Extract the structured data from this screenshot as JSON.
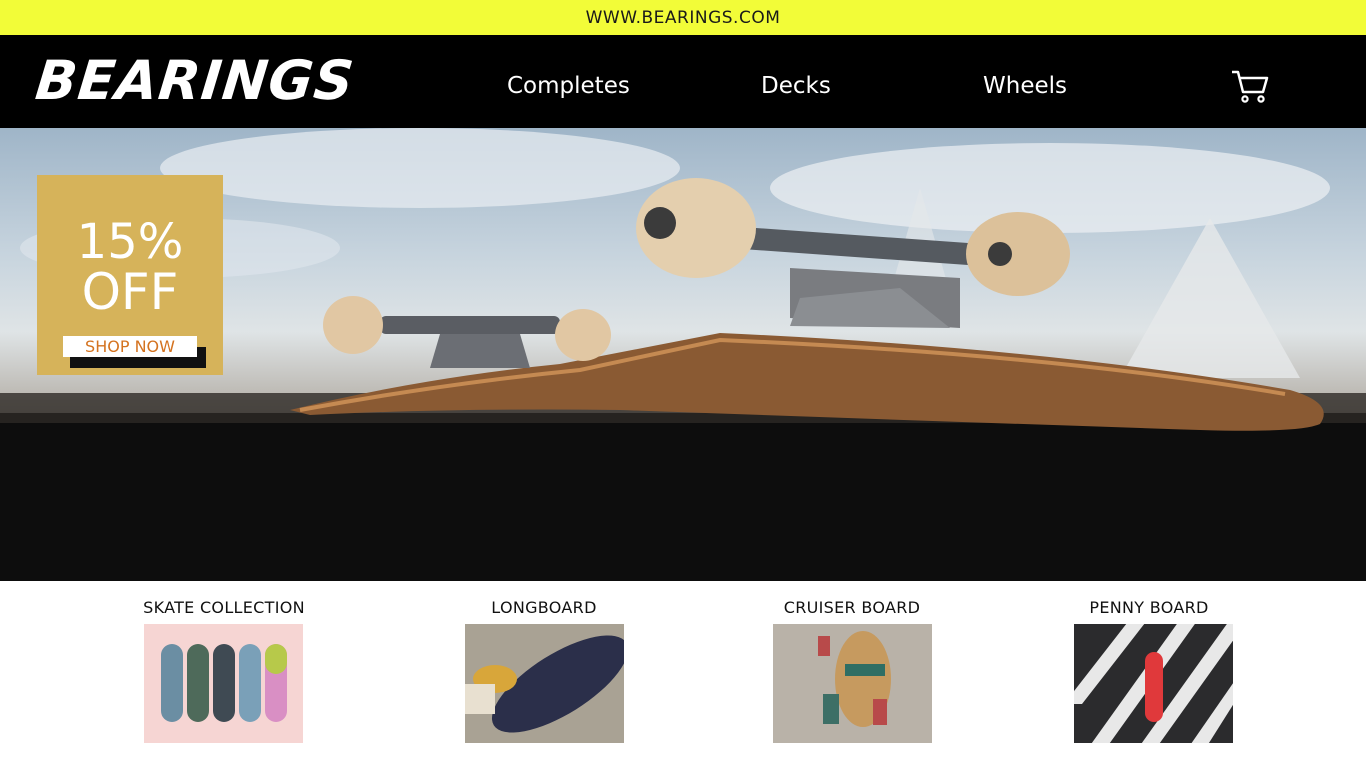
{
  "topbar": {
    "url": "WWW.BEARINGS.COM"
  },
  "nav": {
    "logo": "BEARINGS",
    "links": [
      "Completes",
      "Decks",
      "Wheels"
    ],
    "cart_icon": "cart-icon"
  },
  "hero": {
    "promo": {
      "percent": "15%",
      "off": "OFF",
      "cta": "SHOP NOW"
    },
    "colors": {
      "promo_bg": "#d6b35a",
      "cta_text": "#d47320"
    }
  },
  "categories": [
    {
      "title": "SKATE COLLECTION"
    },
    {
      "title": "LONGBOARD"
    },
    {
      "title": "CRUISER BOARD"
    },
    {
      "title": "PENNY BOARD"
    }
  ],
  "colors": {
    "topbar": "#f2fc38",
    "nav": "#000000"
  }
}
